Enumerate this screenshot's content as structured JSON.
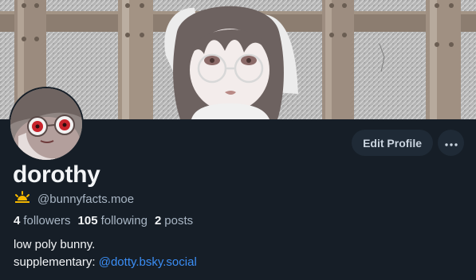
{
  "profile": {
    "display_name": "dorothy",
    "handle": "@bunnyfacts.moe",
    "handle_icon": "sun-icon",
    "bio_line1": "low poly bunny.",
    "bio_line2_prefix": "supplementary:",
    "bio_link": "@dotty.bsky.social"
  },
  "stats": {
    "followers_count": "4",
    "followers_label": "followers",
    "following_count": "105",
    "following_label": "following",
    "posts_count": "2",
    "posts_label": "posts"
  },
  "actions": {
    "edit_label": "Edit Profile",
    "more_icon": "ellipsis-icon"
  },
  "colors": {
    "background": "#161e27",
    "text_primary": "#f2f4f6",
    "text_secondary": "#a9b6c4",
    "link": "#3b8ef5",
    "button_bg": "#1f2a36",
    "sun_icon": "#f5b800"
  }
}
